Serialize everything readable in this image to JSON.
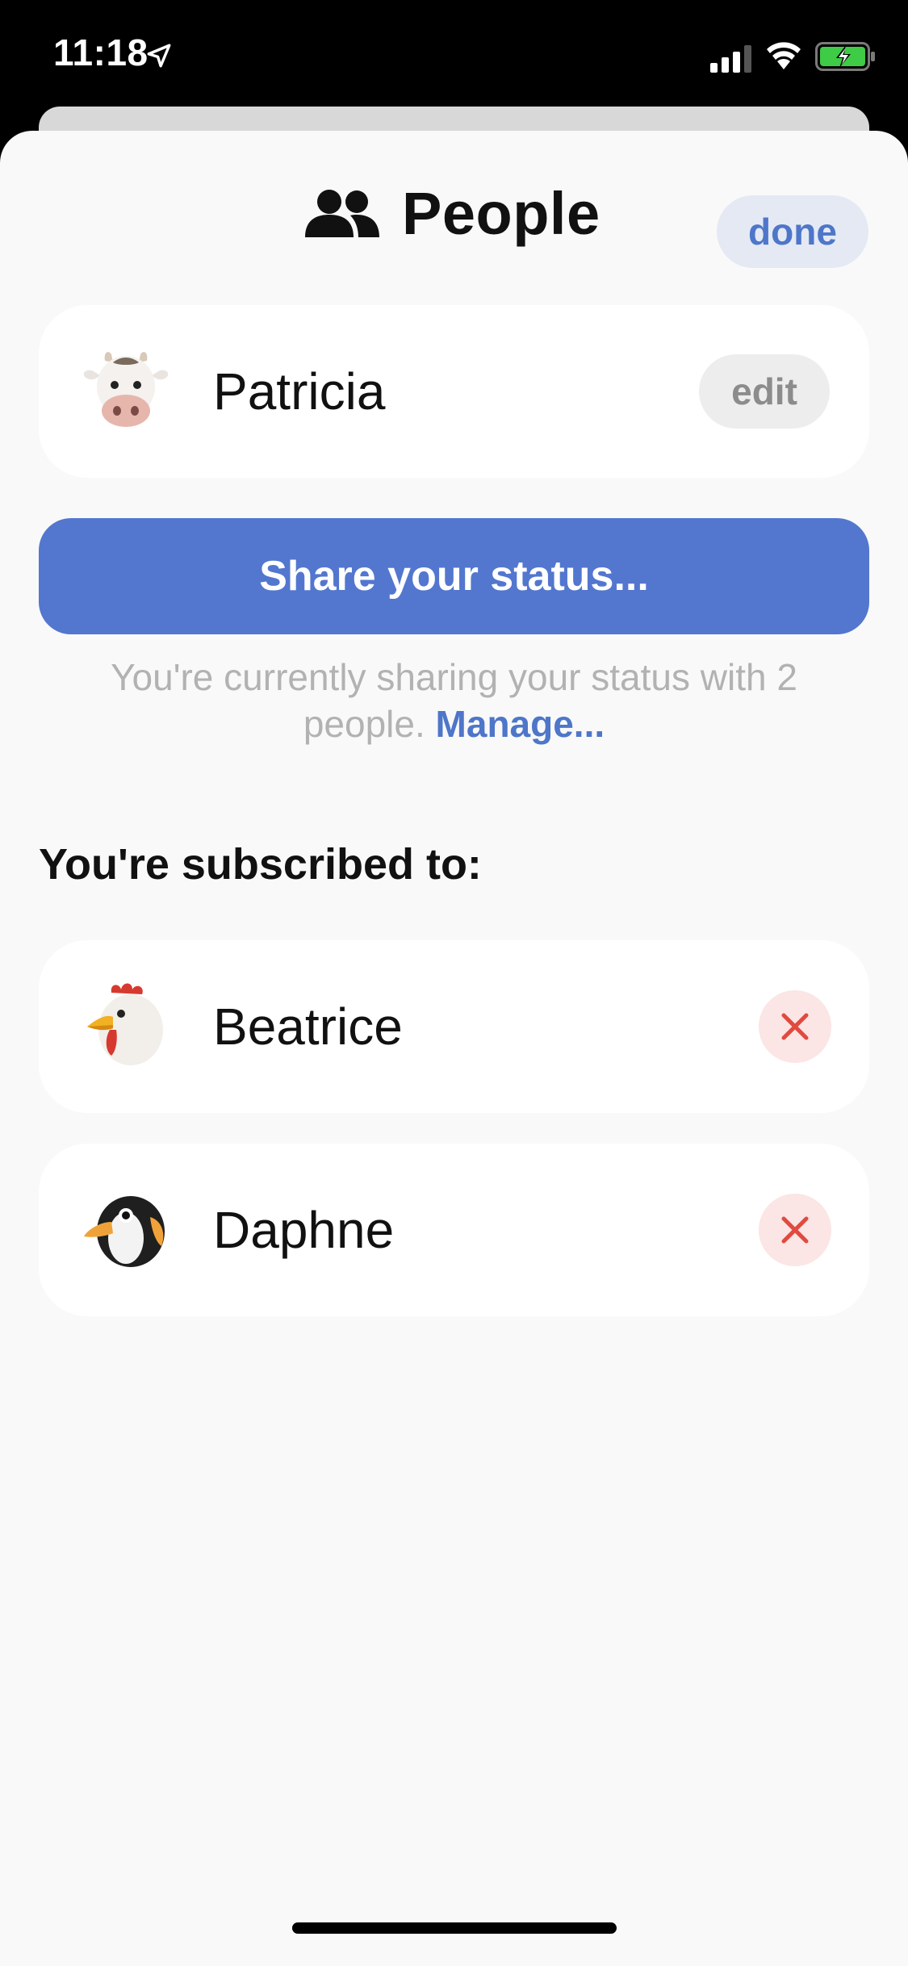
{
  "status_bar": {
    "time": "11:18",
    "icons": [
      "location-arrow-icon",
      "cellular-signal-icon",
      "wifi-icon",
      "battery-charging-icon"
    ]
  },
  "header": {
    "title": "People",
    "icon": "people-icon",
    "done_label": "done"
  },
  "profile": {
    "name": "Patricia",
    "avatar": "cow-emoji",
    "edit_label": "edit"
  },
  "share": {
    "button_label": "Share your status...",
    "note_text": "You're currently sharing your status with 2 people.",
    "manage_label": "Manage..."
  },
  "subscriptions": {
    "title": "You're subscribed to:",
    "items": [
      {
        "name": "Beatrice",
        "avatar": "chicken-emoji",
        "remove_icon": "close-icon"
      },
      {
        "name": "Daphne",
        "avatar": "penguin-emoji",
        "remove_icon": "close-icon"
      }
    ]
  },
  "colors": {
    "accent": "#5377cf",
    "accent_text": "#4e76c9",
    "remove_bg": "#fbe5e5",
    "remove_x": "#e04a3f",
    "sheet_bg": "#f9f9f9"
  }
}
